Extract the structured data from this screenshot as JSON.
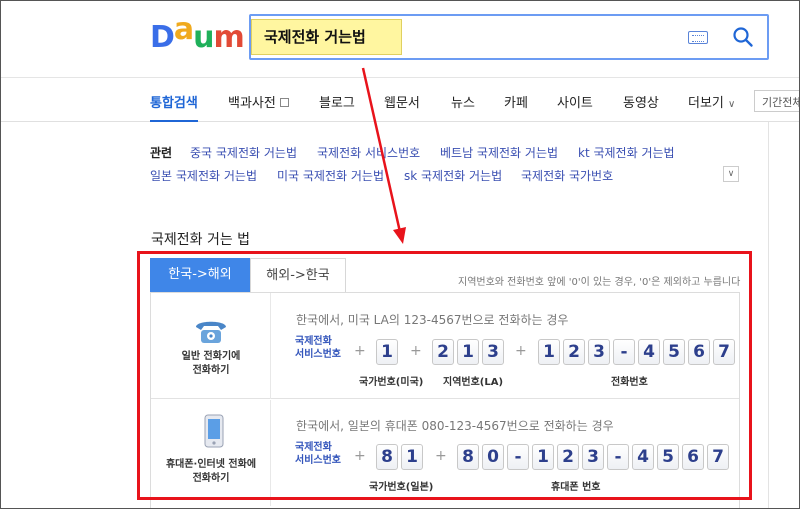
{
  "header": {
    "logo_letters": [
      "D",
      "a",
      "u",
      "m"
    ],
    "logo_colors": [
      "#3a6ee8",
      "#f0aa1e",
      "#1fb05a",
      "#e24a36"
    ],
    "search_value": "국제전화 거는법",
    "brand_blue": "#1f66d6"
  },
  "nav": {
    "items": [
      "통합검색",
      "백과사전",
      "블로그",
      "웹문서",
      "뉴스",
      "카페",
      "사이트",
      "동영상",
      "더보기"
    ],
    "more_chevron": "∨",
    "period_label": "기간전체"
  },
  "related": {
    "label": "관련",
    "links": [
      "중국 국제전화 거는법",
      "국제전화 서비스번호",
      "베트남 국제전화 거는법",
      "kt 국제전화 거는법",
      "일본 국제전화 거는법",
      "미국 국제전화 거는법",
      "sk 국제전화 거는법",
      "국제전화 국가번호"
    ],
    "more_icon": "∨"
  },
  "section": {
    "title": "국제전화 거는 법"
  },
  "widget": {
    "tabs": [
      "한국->해외",
      "해외->한국"
    ],
    "note": "지역번호와 전화번호 앞에 '0'이 있는 경우, '0'은 제외하고 누릅니다",
    "rows": [
      {
        "icon_caption_1": "일반 전화기에",
        "icon_caption_2": "전화하기",
        "description": "한국에서, 미국 LA의 123-4567번으로 전화하는 경우",
        "service_1": "국제전화",
        "service_2": "서비스번호",
        "plus": "+",
        "country_digits": [
          "1"
        ],
        "country_label": "국가번호(미국)",
        "area_digits": [
          "2",
          "1",
          "3"
        ],
        "area_label": "지역번호(LA)",
        "phone_digits": [
          "1",
          "2",
          "3",
          "-",
          "4",
          "5",
          "6",
          "7"
        ],
        "phone_label": "전화번호"
      },
      {
        "icon_caption_1": "휴대폰·인터넷 전화에",
        "icon_caption_2": "전화하기",
        "description": "한국에서, 일본의 휴대폰 080-123-4567번으로 전화하는 경우",
        "service_1": "국제전화",
        "service_2": "서비스번호",
        "plus": "+",
        "country_digits": [
          "8",
          "1"
        ],
        "country_label": "국가번호(일본)",
        "phone_digits": [
          "8",
          "0",
          "-",
          "1",
          "2",
          "3",
          "-",
          "4",
          "5",
          "6",
          "7"
        ],
        "phone_label": "휴대폰 번호"
      }
    ]
  },
  "annotation": {
    "highlight_color": "#e8131b"
  }
}
